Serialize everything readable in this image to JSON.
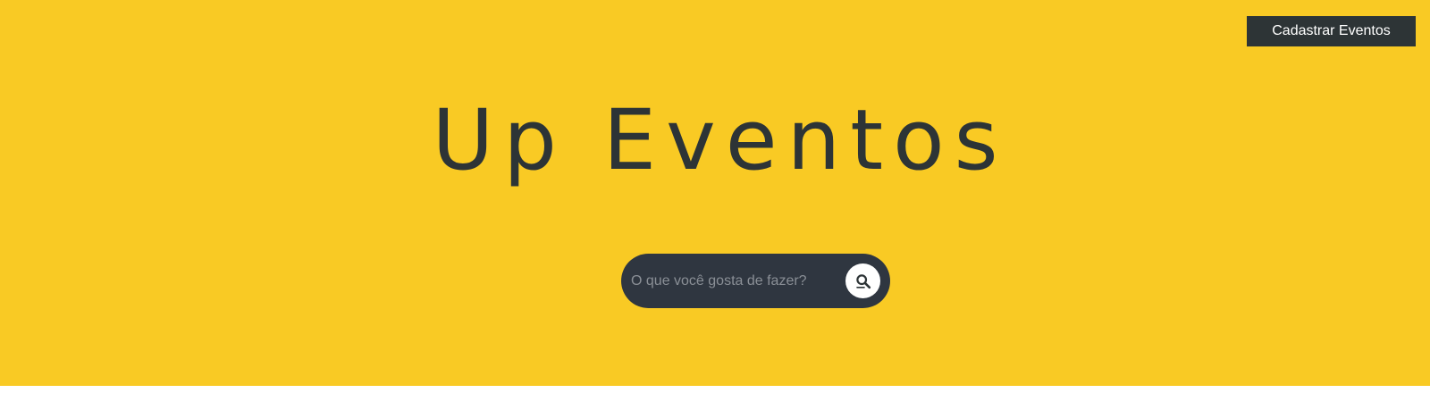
{
  "header": {
    "register_button_label": "Cadastrar Eventos"
  },
  "hero": {
    "title": "Up Eventos"
  },
  "search": {
    "placeholder": "O que você gosta de fazer?",
    "value": "",
    "button_icon": "search-icon"
  },
  "colors": {
    "background": "#f9ca24",
    "dark": "#2d3436",
    "search_bar": "#2f3640",
    "placeholder": "#8a8f96"
  }
}
